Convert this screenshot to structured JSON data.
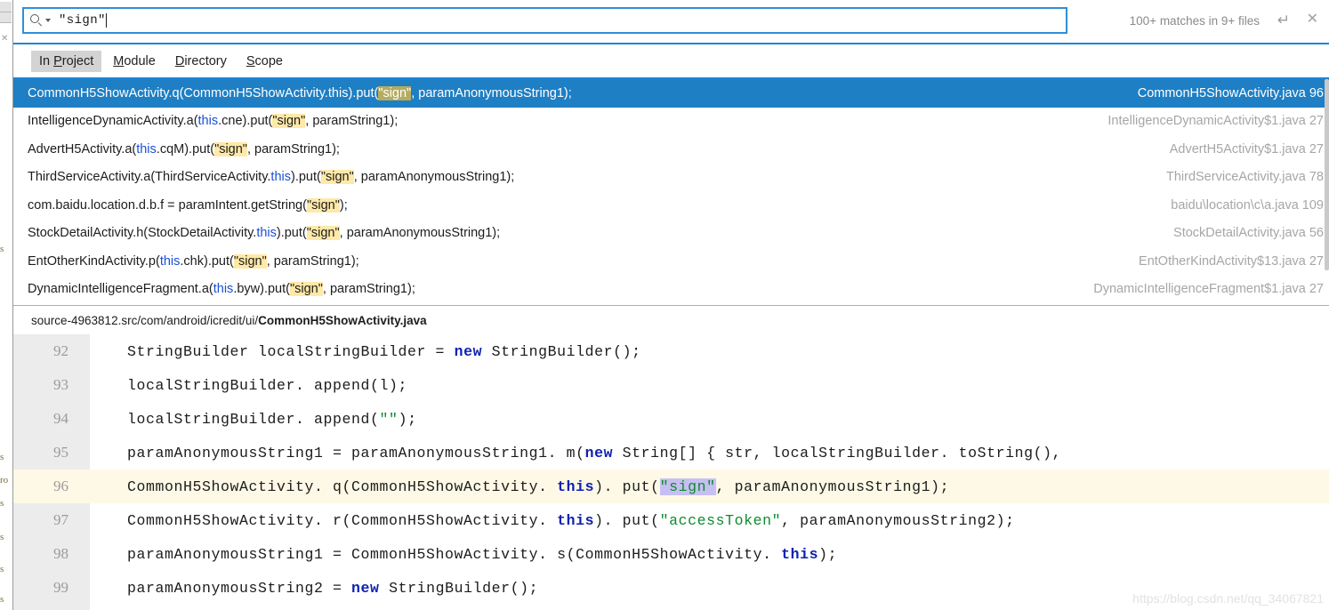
{
  "search": {
    "query": "″sign″",
    "icon": "search-icon",
    "dropdown_icon": "chevron-down-icon",
    "match_count": "100+ matches in 9+ files",
    "enter_icon": "↵",
    "close_icon": "✕"
  },
  "scope_tabs": [
    {
      "pre": "In ",
      "mnemonic": "P",
      "post": "roject",
      "active": true
    },
    {
      "pre": "",
      "mnemonic": "M",
      "post": "odule",
      "active": false
    },
    {
      "pre": "",
      "mnemonic": "D",
      "post": "irectory",
      "active": false
    },
    {
      "pre": "",
      "mnemonic": "S",
      "post": "cope",
      "active": false
    }
  ],
  "results": [
    {
      "selected": true,
      "parts": [
        {
          "t": "CommonH5ShowActivity.q(CommonH5ShowActivity.this).put(",
          "k": "plain"
        },
        {
          "t": "\"sign\"",
          "k": "hl"
        },
        {
          "t": ", paramAnonymousString1);",
          "k": "plain"
        }
      ],
      "file": "CommonH5ShowActivity.java 96"
    },
    {
      "selected": false,
      "parts": [
        {
          "t": "IntelligenceDynamicActivity.a(",
          "k": "plain"
        },
        {
          "t": "this",
          "k": "kw"
        },
        {
          "t": ".cne).put(",
          "k": "plain"
        },
        {
          "t": "\"sign\"",
          "k": "hl"
        },
        {
          "t": ", paramString1);",
          "k": "plain"
        }
      ],
      "file": "IntelligenceDynamicActivity$1.java 27"
    },
    {
      "selected": false,
      "parts": [
        {
          "t": "AdvertH5Activity.a(",
          "k": "plain"
        },
        {
          "t": "this",
          "k": "kw"
        },
        {
          "t": ".cqM).put(",
          "k": "plain"
        },
        {
          "t": "\"sign\"",
          "k": "hl"
        },
        {
          "t": ", paramString1);",
          "k": "plain"
        }
      ],
      "file": "AdvertH5Activity$1.java 27"
    },
    {
      "selected": false,
      "parts": [
        {
          "t": "ThirdServiceActivity.a(ThirdServiceActivity.",
          "k": "plain"
        },
        {
          "t": "this",
          "k": "kw"
        },
        {
          "t": ").put(",
          "k": "plain"
        },
        {
          "t": "\"sign\"",
          "k": "hl"
        },
        {
          "t": ", paramAnonymousString1);",
          "k": "plain"
        }
      ],
      "file": "ThirdServiceActivity.java 78"
    },
    {
      "selected": false,
      "parts": [
        {
          "t": "com.baidu.location.d.b.f = paramIntent.getString(",
          "k": "plain"
        },
        {
          "t": "\"sign\"",
          "k": "hl"
        },
        {
          "t": ");",
          "k": "plain"
        }
      ],
      "file": "baidu\\location\\c\\a.java 109"
    },
    {
      "selected": false,
      "parts": [
        {
          "t": "StockDetailActivity.h(StockDetailActivity.",
          "k": "plain"
        },
        {
          "t": "this",
          "k": "kw"
        },
        {
          "t": ").put(",
          "k": "plain"
        },
        {
          "t": "\"sign\"",
          "k": "hl"
        },
        {
          "t": ", paramAnonymousString1);",
          "k": "plain"
        }
      ],
      "file": "StockDetailActivity.java 56"
    },
    {
      "selected": false,
      "parts": [
        {
          "t": "EntOtherKindActivity.p(",
          "k": "plain"
        },
        {
          "t": "this",
          "k": "kw"
        },
        {
          "t": ".chk).put(",
          "k": "plain"
        },
        {
          "t": "\"sign\"",
          "k": "hl"
        },
        {
          "t": ", paramString1);",
          "k": "plain"
        }
      ],
      "file": "EntOtherKindActivity$13.java 27"
    },
    {
      "selected": false,
      "parts": [
        {
          "t": "DynamicIntelligenceFragment.a(",
          "k": "plain"
        },
        {
          "t": "this",
          "k": "kw"
        },
        {
          "t": ".byw).put(",
          "k": "plain"
        },
        {
          "t": "\"sign\"",
          "k": "hl"
        },
        {
          "t": ", paramString1);",
          "k": "plain"
        }
      ],
      "file": "DynamicIntelligenceFragment$1.java 27"
    }
  ],
  "breadcrumb": {
    "path": "source-4963812.src/com/android/icredit/ui/",
    "file": "CommonH5ShowActivity.java"
  },
  "code": {
    "lines": [
      {
        "number": "92",
        "current": false,
        "parts": [
          {
            "t": "StringBuilder localStringBuilder = ",
            "k": "plain"
          },
          {
            "t": "new",
            "k": "kw"
          },
          {
            "t": " StringBuilder();",
            "k": "plain"
          }
        ]
      },
      {
        "number": "93",
        "current": false,
        "parts": [
          {
            "t": "localStringBuilder. append(l);",
            "k": "plain"
          }
        ]
      },
      {
        "number": "94",
        "current": false,
        "parts": [
          {
            "t": "localStringBuilder. append(",
            "k": "plain"
          },
          {
            "t": "″″",
            "k": "str"
          },
          {
            "t": ");",
            "k": "plain"
          }
        ]
      },
      {
        "number": "95",
        "current": false,
        "parts": [
          {
            "t": "paramAnonymousString1 = paramAnonymousString1. m(",
            "k": "plain"
          },
          {
            "t": "new",
            "k": "kw"
          },
          {
            "t": " String[] { str, localStringBuilder. toString(),",
            "k": "plain"
          }
        ]
      },
      {
        "number": "96",
        "current": true,
        "parts": [
          {
            "t": "CommonH5ShowActivity. q(CommonH5ShowActivity. ",
            "k": "plain"
          },
          {
            "t": "this",
            "k": "kw"
          },
          {
            "t": "). put(",
            "k": "plain"
          },
          {
            "t": "″sign″",
            "k": "sel-str"
          },
          {
            "t": ", paramAnonymousString1);",
            "k": "plain"
          }
        ]
      },
      {
        "number": "97",
        "current": false,
        "parts": [
          {
            "t": "CommonH5ShowActivity. r(CommonH5ShowActivity. ",
            "k": "plain"
          },
          {
            "t": "this",
            "k": "kw"
          },
          {
            "t": "). put(",
            "k": "plain"
          },
          {
            "t": "″accessToken″",
            "k": "str"
          },
          {
            "t": ", paramAnonymousString2);",
            "k": "plain"
          }
        ]
      },
      {
        "number": "98",
        "current": false,
        "parts": [
          {
            "t": "paramAnonymousString1 = CommonH5ShowActivity. s(CommonH5ShowActivity. ",
            "k": "plain"
          },
          {
            "t": "this",
            "k": "kw"
          },
          {
            "t": ");",
            "k": "plain"
          }
        ]
      },
      {
        "number": "99",
        "current": false,
        "parts": [
          {
            "t": "paramAnonymousString2 = ",
            "k": "plain"
          },
          {
            "t": "new",
            "k": "kw"
          },
          {
            "t": " StringBuilder();",
            "k": "plain"
          }
        ]
      }
    ]
  },
  "watermark": "https://blog.csdn.net/qq_34067821",
  "colors": {
    "accent": "#1f7fc4",
    "search_border": "#2f8fd8",
    "match_highlight": "#ffe9a8",
    "selected_match_highlight": "#b5ac60",
    "current_line": "#fdf9e6",
    "selection": "#c6c0f2",
    "string": "#0f8a2e",
    "keyword": "#0d22b0"
  }
}
